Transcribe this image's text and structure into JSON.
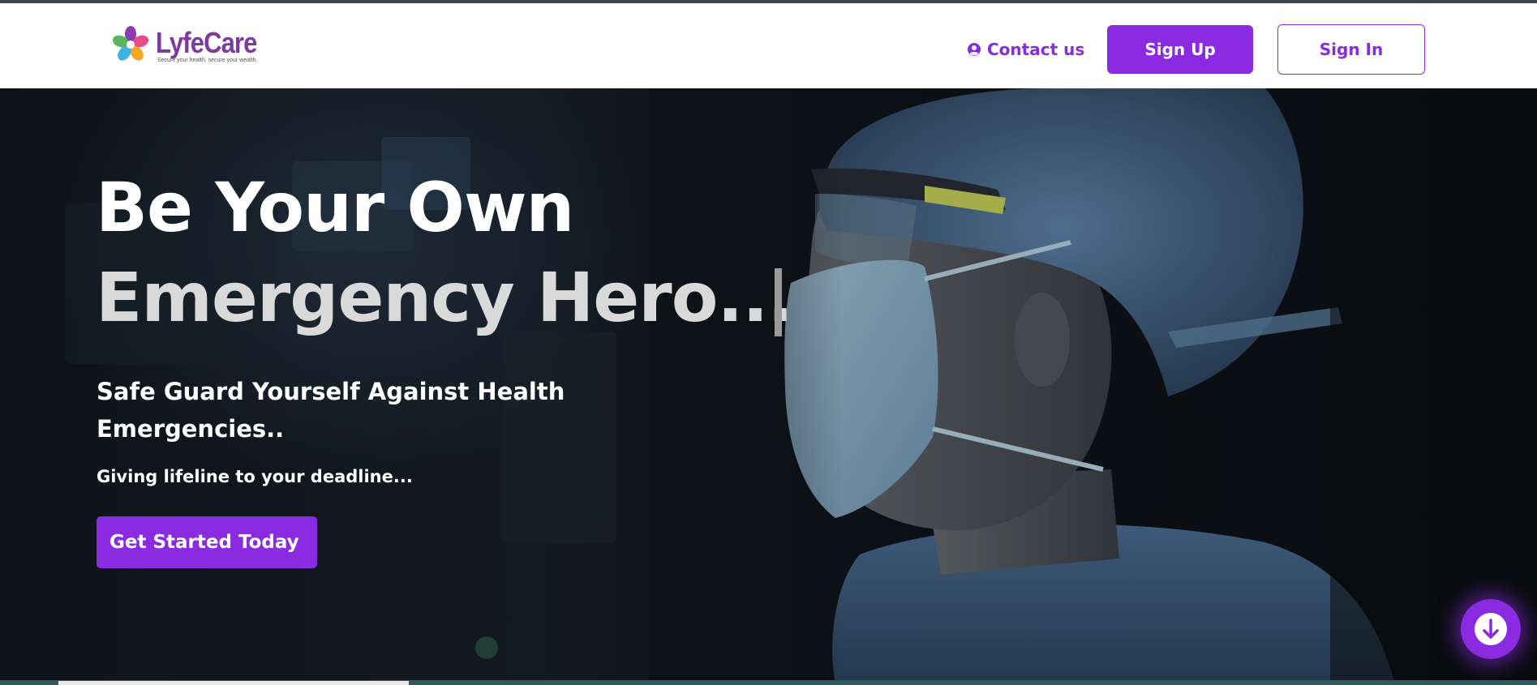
{
  "brand": {
    "name": "LyfeCare",
    "tagline": "Secure your health, secure your wealth.",
    "logo_colors": [
      "#8a3bb0",
      "#e94b8a",
      "#f5a623",
      "#3cb5e5",
      "#5ab55e"
    ]
  },
  "nav": {
    "contact_label": "Contact us",
    "contact_icon": "user-circle-icon",
    "signup_label": "Sign Up",
    "signin_label": "Sign In"
  },
  "hero": {
    "headline_line1": "Be Your Own",
    "headline_line2": "Emergency Hero...",
    "subheading": "Safe Guard Yourself Against Health Emergencies..",
    "tagline": "Giving lifeline to your deadline...",
    "cta_label": "Get Started Today",
    "scroll_icon": "arrow-down-circle-icon"
  },
  "colors": {
    "accent": "#8a2be2",
    "navbar_bg": "#ffffff",
    "hero_text": "#ffffff",
    "hero_text_secondary": "#d9d9d9"
  }
}
